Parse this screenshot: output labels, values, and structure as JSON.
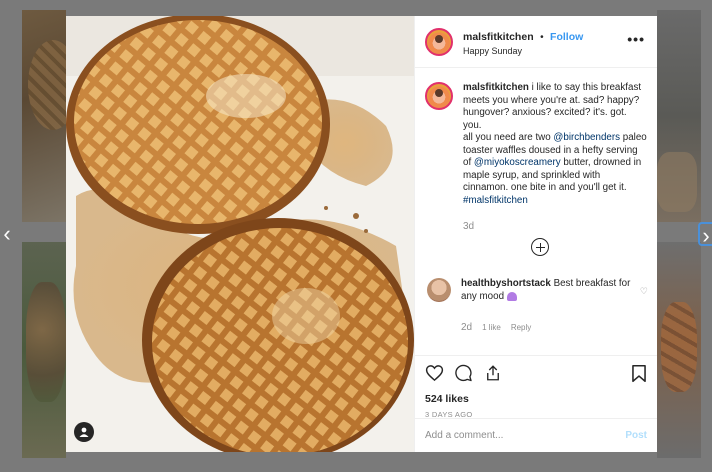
{
  "post": {
    "username": "malsfitkitchen",
    "separator": "•",
    "follow_label": "Follow",
    "location": "Happy Sunday",
    "more_label": "•••"
  },
  "caption": {
    "username": "malsfitkitchen",
    "text1": "i like to say this breakfast meets you where you're at. sad? happy? hungover? anxious? excited? it's. got. you.",
    "text2": "all you need are two",
    "mention1": "@birchbenders",
    "text3": "paleo toaster waffles doused in a hefty serving of",
    "mention2": "@miyokoscreamery",
    "text4": "butter, drowned in maple syrup, and sprinkled with cinnamon. one bite in and you'll get it.",
    "hashtag": "#malsfitkitchen",
    "time": "3d"
  },
  "comment": {
    "username": "healthbyshortstack",
    "text": "Best breakfast for any mood",
    "emoji": "purple-heart",
    "time": "2d",
    "likes": "1 like",
    "reply": "Reply"
  },
  "actions": {
    "likes": "524 likes",
    "post_time": "3 DAYS AGO",
    "comment_placeholder": "Add a comment...",
    "post_label": "Post"
  },
  "nav": {
    "prev": "‹",
    "next": "›"
  },
  "colors": {
    "link": "#3897f0",
    "mention": "#003569",
    "muted": "#8e8e8e",
    "post_disabled": "#b2dffc"
  }
}
